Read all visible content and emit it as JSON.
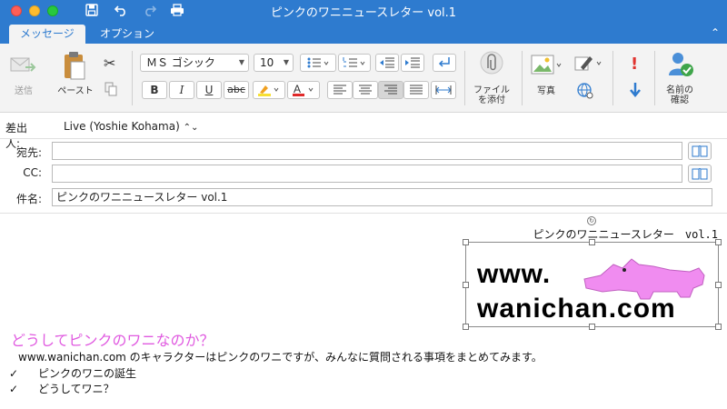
{
  "window": {
    "title": "ピンクのワニニュースレター vol.1",
    "tabs": [
      {
        "label": "メッセージ",
        "active": true
      },
      {
        "label": "オプション",
        "active": false
      }
    ]
  },
  "ribbon": {
    "send_label": "送信",
    "paste_label": "ペースト",
    "font_name": "ＭＳ ゴシック",
    "font_size": "10",
    "bold": "B",
    "italic": "I",
    "underline": "U",
    "strikethrough": "abc",
    "attach_label_1": "ファイル",
    "attach_label_2": "を添付",
    "photo_label": "写真",
    "check_names_label_1": "名前の",
    "check_names_label_2": "確認",
    "colors": {
      "highlight": "#f7e034",
      "font_color": "#e02a2a",
      "importance_high": "#e0332f",
      "importance_low": "#2e7bcf"
    }
  },
  "header": {
    "from_label": "差出人:",
    "from_value": "Live (Yoshie Kohama)",
    "to_label": "宛先:",
    "to_value": "",
    "cc_label": "CC:",
    "cc_value": "",
    "subject_label": "件名:",
    "subject_value": "ピンクのワニニュースレター vol.1"
  },
  "body": {
    "newsletter_title": "ピンクのワニニュースレター　vol.1",
    "logo_line1": "www.",
    "logo_line2": "wanichan.com",
    "heading": "どうしてピンクのワニなのか？",
    "paragraph": "www.wanichan.com のキャラクターはピンクのワニですが、みんなに質問される事項をまとめてみます。",
    "checklist": [
      "ピンクのワニの誕生",
      "どうしてワニ？"
    ],
    "colors": {
      "heading": "#e05ae0",
      "crocodile": "#f08cf0"
    }
  }
}
